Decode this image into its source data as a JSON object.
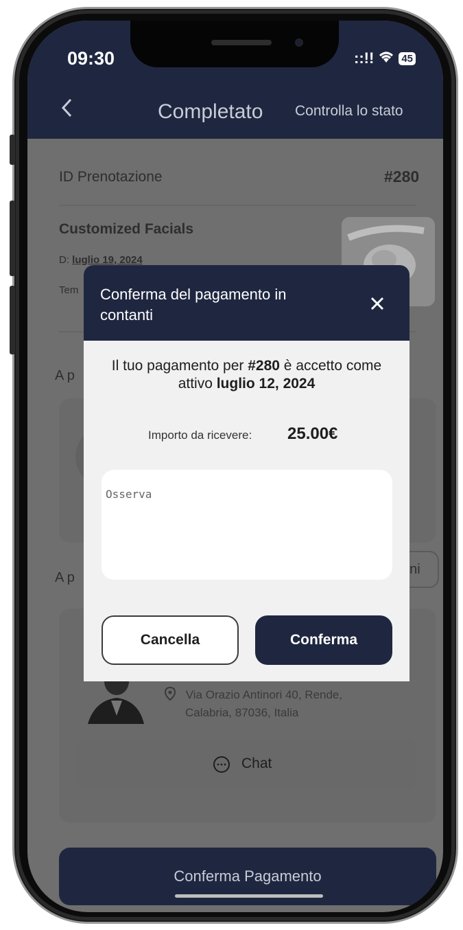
{
  "status_bar": {
    "time": "09:30",
    "signal": "::!!",
    "wifi": "wifi-icon",
    "battery": "45"
  },
  "header": {
    "back_icon": "chevron-left-icon",
    "title": "Completato",
    "status_link": "Controlla lo stato"
  },
  "booking": {
    "id_label": "ID Prenotazione",
    "id_value": "#280",
    "service_name": "Customized Facials",
    "date_prefix": "D:",
    "date_value": "luglio 19, 2024",
    "time_prefix": "Tem"
  },
  "background": {
    "section1_partial": "A p",
    "section2_partial": "A p",
    "chip_partial": "oni",
    "address_line1": "Via Orazio Antinori 40, Rende,",
    "address_line2": "Calabria, 87036, Italia",
    "chat_label": "Chat",
    "confirm_payment_label": "Conferma Pagamento"
  },
  "modal": {
    "title": "Conferma del pagamento in contanti",
    "msg_prefix": "Il tuo pagamento per ",
    "msg_id": "#280",
    "msg_middle": " è accetto come attivo ",
    "msg_date": "luglio 12, 2024",
    "amount_label": "Importo da ricevere:",
    "amount_value": "25.00€",
    "note_placeholder": "Osserva",
    "cancel_label": "Cancella",
    "confirm_label": "Conferma"
  },
  "colors": {
    "navy": "#1f2740",
    "overlay": "#6f6f6f",
    "modal_bg": "#f1f1f1"
  }
}
